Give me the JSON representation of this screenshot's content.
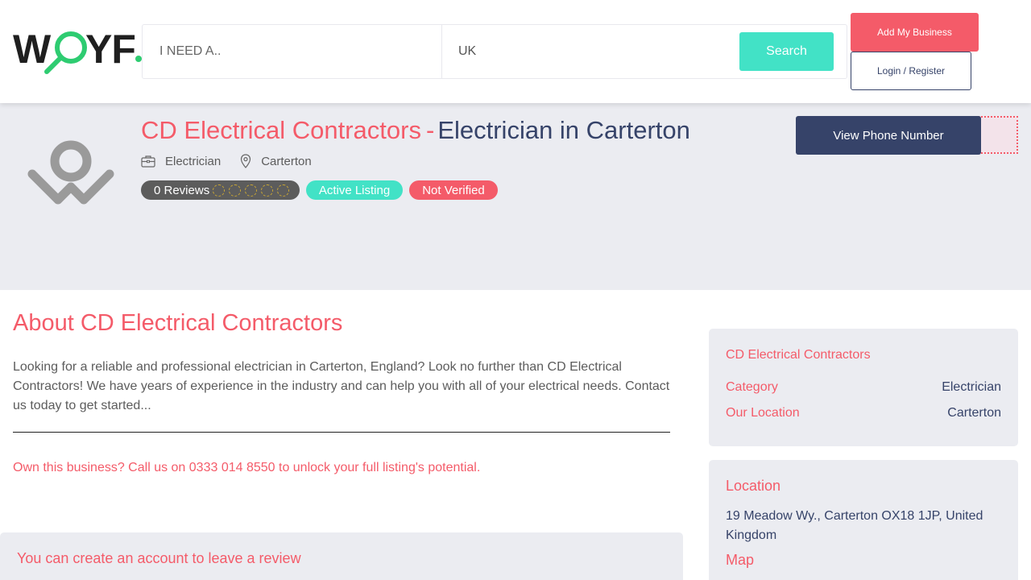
{
  "header": {
    "logo_text": "WGYF.",
    "search": {
      "need_placeholder": "I NEED A..",
      "location_value": "UK",
      "button_label": "Search"
    },
    "add_business_label": "Add My Business",
    "login_label": "Login / Register"
  },
  "listing": {
    "name": "CD Electrical Contractors",
    "separator": "-",
    "subtitle": "Electrician in Carterton",
    "category": "Electrician",
    "location": "Carterton",
    "badges": {
      "reviews": "0 Reviews",
      "rating": 0,
      "max_rating": 5,
      "active": "Active Listing",
      "verified": "Not Verified"
    },
    "view_phone_label": "View Phone Number"
  },
  "about": {
    "title": "About CD Electrical Contractors",
    "text": "Looking for a reliable and professional electrician in Carterton, England? Look no further than CD Electrical Contractors! We have years of experience in the industry and can help you with all of your electrical needs. Contact us today to get started...",
    "own_business": "Own this business? Call us on 0333 014 8550 to unlock your full listing's potential.",
    "review_prompt": "You can create an account to leave a review"
  },
  "sidebar": {
    "info_card": {
      "title": "CD Electrical Contractors",
      "category_label": "Category",
      "category_value": "Electrician",
      "location_label": "Our Location",
      "location_value": "Carterton"
    },
    "location_card": {
      "title": "Location",
      "address": "19 Meadow Wy., Carterton OX18 1JP, United Kingdom",
      "map_label": "Map"
    }
  },
  "colors": {
    "brand_red": "#f45b69",
    "brand_teal": "#42e2c6",
    "brand_navy": "#364369",
    "panel_bg": "#ebecf1"
  }
}
